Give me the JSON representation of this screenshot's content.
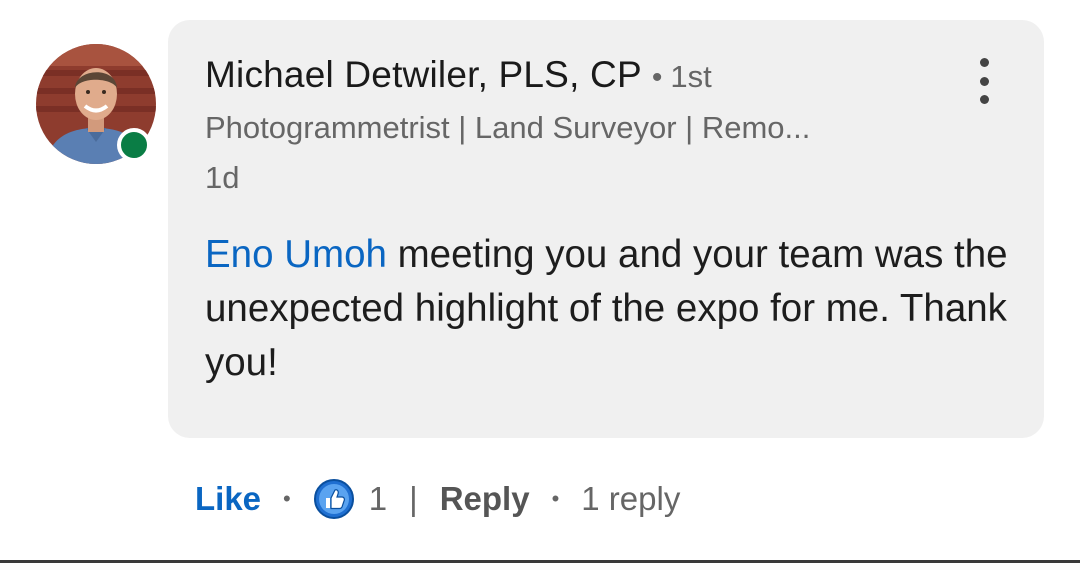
{
  "comment": {
    "author": {
      "name": "Michael Detwiler, PLS, CP",
      "separator": "•",
      "degree": "1st",
      "headline": "Photogrammetrist | Land Surveyor | Remo...",
      "online": true,
      "avatar_icon": "profile-photo"
    },
    "timestamp": "1d",
    "mention": "Eno Umoh",
    "text": " meeting you and your team was the unexpected highlight of the expo for me. Thank you!",
    "more_icon": "vertical-ellipsis-icon"
  },
  "actions": {
    "like_label": "Like",
    "dot1": "•",
    "reaction_icon": "thumbs-up-icon",
    "reaction_count": "1",
    "pipe": "|",
    "reply_label": "Reply",
    "dot2": "•",
    "reply_count_label": "1 reply"
  },
  "colors": {
    "link_blue": "#0a66c2",
    "online_green": "#0a7d45",
    "bubble_bg": "#f0f0f0"
  }
}
